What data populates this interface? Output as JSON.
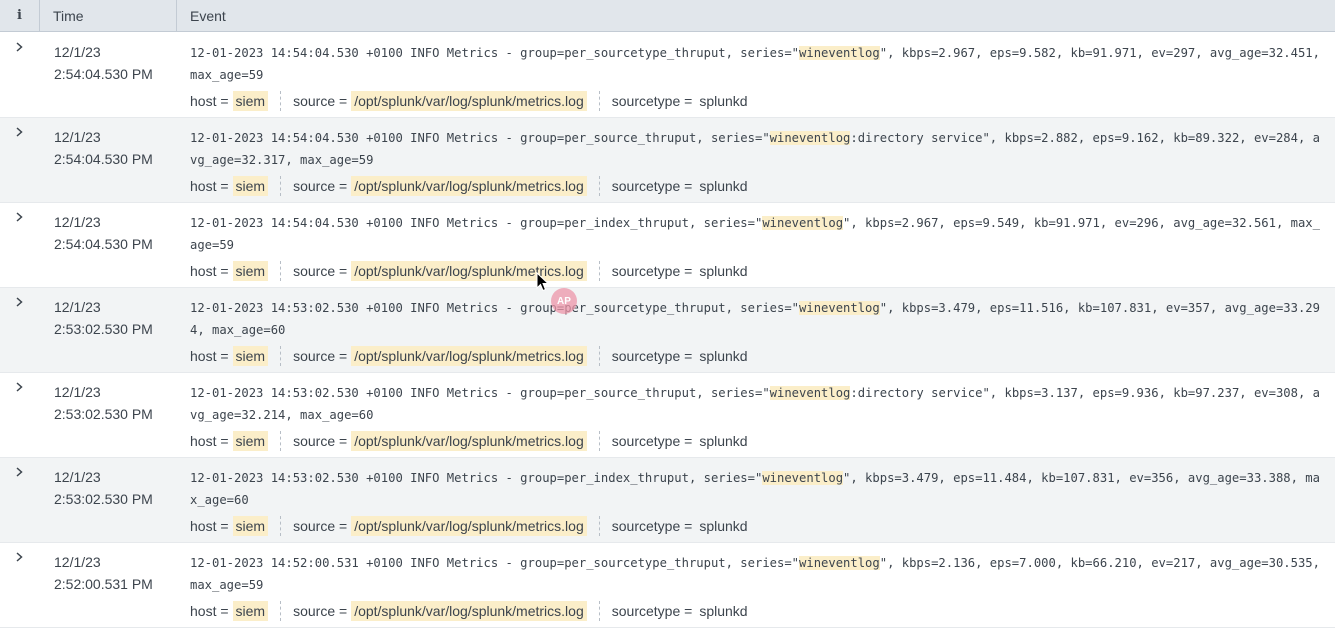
{
  "header": {
    "info_icon": "i",
    "time": "Time",
    "event": "Event"
  },
  "colors": {
    "highlight": "#fbeec9",
    "header_bg": "#e1e6eb",
    "alt_row": "#f2f4f5",
    "badge": "#ec96a8"
  },
  "cursor_badge": "AP",
  "fields_labels": {
    "host": "host =",
    "source": "source =",
    "sourcetype": "sourcetype ="
  },
  "rows": [
    {
      "date": "12/1/23",
      "time": "2:54:04.530 PM",
      "raw_before": "12-01-2023 14:54:04.530 +0100 INFO  Metrics - group=per_sourcetype_thruput, series=\"",
      "raw_hl": "wineventlog",
      "raw_after": "\", kbps=2.967, eps=9.582, kb=91.971, ev=297, avg_age=32.451, max_age=59",
      "host": "siem",
      "source": "/opt/splunk/var/log/splunk/metrics.log",
      "sourcetype": "splunkd"
    },
    {
      "date": "12/1/23",
      "time": "2:54:04.530 PM",
      "raw_before": "12-01-2023 14:54:04.530 +0100 INFO  Metrics - group=per_source_thruput, series=\"",
      "raw_hl": "wineventlog",
      "raw_after": ":directory service\", kbps=2.882, eps=9.162, kb=89.322, ev=284, avg_age=32.317, max_age=59",
      "host": "siem",
      "source": "/opt/splunk/var/log/splunk/metrics.log",
      "sourcetype": "splunkd"
    },
    {
      "date": "12/1/23",
      "time": "2:54:04.530 PM",
      "raw_before": "12-01-2023 14:54:04.530 +0100 INFO  Metrics - group=per_index_thruput, series=\"",
      "raw_hl": "wineventlog",
      "raw_after": "\", kbps=2.967, eps=9.549, kb=91.971, ev=296, avg_age=32.561, max_age=59",
      "host": "siem",
      "source": "/opt/splunk/var/log/splunk/metrics.log",
      "sourcetype": "splunkd"
    },
    {
      "date": "12/1/23",
      "time": "2:53:02.530 PM",
      "raw_before": "12-01-2023 14:53:02.530 +0100 INFO  Metrics - group=per_sourcetype_thruput, series=\"",
      "raw_hl": "wineventlog",
      "raw_after": "\", kbps=3.479, eps=11.516, kb=107.831, ev=357, avg_age=33.294, max_age=60",
      "host": "siem",
      "source": "/opt/splunk/var/log/splunk/metrics.log",
      "sourcetype": "splunkd"
    },
    {
      "date": "12/1/23",
      "time": "2:53:02.530 PM",
      "raw_before": "12-01-2023 14:53:02.530 +0100 INFO  Metrics - group=per_source_thruput, series=\"",
      "raw_hl": "wineventlog",
      "raw_after": ":directory service\", kbps=3.137, eps=9.936, kb=97.237, ev=308, avg_age=32.214, max_age=60",
      "host": "siem",
      "source": "/opt/splunk/var/log/splunk/metrics.log",
      "sourcetype": "splunkd"
    },
    {
      "date": "12/1/23",
      "time": "2:53:02.530 PM",
      "raw_before": "12-01-2023 14:53:02.530 +0100 INFO  Metrics - group=per_index_thruput, series=\"",
      "raw_hl": "wineventlog",
      "raw_after": "\", kbps=3.479, eps=11.484, kb=107.831, ev=356, avg_age=33.388, max_age=60",
      "host": "siem",
      "source": "/opt/splunk/var/log/splunk/metrics.log",
      "sourcetype": "splunkd"
    },
    {
      "date": "12/1/23",
      "time": "2:52:00.531 PM",
      "raw_before": "12-01-2023 14:52:00.531 +0100 INFO  Metrics - group=per_sourcetype_thruput, series=\"",
      "raw_hl": "wineventlog",
      "raw_after": "\", kbps=2.136, eps=7.000, kb=66.210, ev=217, avg_age=30.535, max_age=59",
      "host": "siem",
      "source": "/opt/splunk/var/log/splunk/metrics.log",
      "sourcetype": "splunkd"
    }
  ]
}
